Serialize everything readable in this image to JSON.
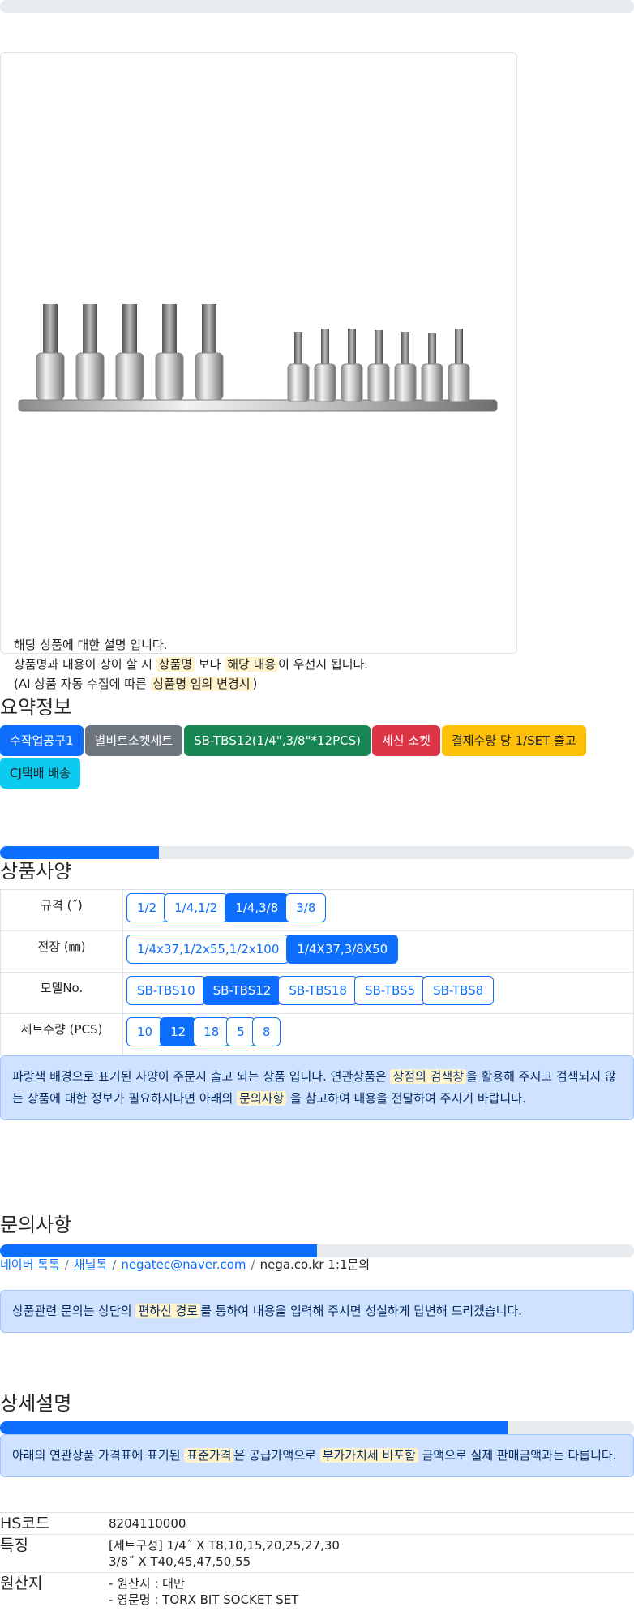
{
  "product": {
    "description_lines": [
      {
        "parts": [
          {
            "text": "해당 상품에 대한 설명 입니다.",
            "hl": false
          }
        ]
      },
      {
        "parts": [
          {
            "text": "상품명과 내용이 상이 할 시 ",
            "hl": false
          },
          {
            "text": "상품명",
            "hl": true
          },
          {
            "text": " 보다 ",
            "hl": false
          },
          {
            "text": "해당 내용",
            "hl": true
          },
          {
            "text": "이 우선시 됩니다.",
            "hl": false
          }
        ]
      },
      {
        "parts": [
          {
            "text": "(AI 상품 자동 수집에 따른 ",
            "hl": false
          },
          {
            "text": "상품명 임의 변경시",
            "hl": true
          },
          {
            "text": ")",
            "hl": false
          }
        ]
      }
    ]
  },
  "summary": {
    "title": "요약정보",
    "badges": [
      {
        "label": "수작업공구1",
        "color": "blue"
      },
      {
        "label": "별비트소켓세트",
        "color": "gray"
      },
      {
        "label": "SB-TBS12(1/4\",3/8\"*12PCS)",
        "color": "green"
      },
      {
        "label": "세신 소켓",
        "color": "red"
      },
      {
        "label": "결제수량 당 1/SET 출고",
        "color": "yellow"
      },
      {
        "label": "CJ택배 배송",
        "color": "cyan"
      }
    ]
  },
  "spec": {
    "title": "상품사양",
    "progress": 0.25,
    "rows": [
      {
        "label": "규격 (˝)",
        "options": [
          "1/2",
          "1/4,1/2",
          "1/4,3/8",
          "3/8"
        ],
        "selected": 2
      },
      {
        "label": "전장 (㎜)",
        "options": [
          "1/4x37,1/2x55,1/2x100",
          "1/4X37,3/8X50"
        ],
        "selected": 1
      },
      {
        "label": "모델No.",
        "options": [
          "SB-TBS10",
          "SB-TBS12",
          "SB-TBS18",
          "SB-TBS5",
          "SB-TBS8"
        ],
        "selected": 1
      },
      {
        "label": "세트수량 (PCS)",
        "options": [
          "10",
          "12",
          "18",
          "5",
          "8"
        ],
        "selected": 1
      }
    ],
    "notice": [
      {
        "text": "파랑색 배경으로 표기된 사양이 주문시 출고 되는 상품 입니다. 연관상품은 ",
        "hl": false
      },
      {
        "text": "상점의 검색창",
        "hl": true
      },
      {
        "text": "을 활용해 주시고 검색되지 않는 상품에 대한 정보가 필요하시다면 아래의 ",
        "hl": false
      },
      {
        "text": "문의사항",
        "hl": true
      },
      {
        "text": " 을 참고하여 내용을 전달하여 주시기 바랍니다.",
        "hl": false
      }
    ]
  },
  "inquiry": {
    "title": "문의사항",
    "progress": 0.5,
    "links": [
      "네이버 톡톡",
      "채널톡",
      "negatec@naver.com"
    ],
    "plain": "nega.co.kr 1:1문의",
    "notice": [
      {
        "text": "상품관련 문의는 상단의 ",
        "hl": false
      },
      {
        "text": "편하신 경로",
        "hl": true
      },
      {
        "text": "를 통하여 내용을 입력해 주시면 성실하게 답변해 드리겠습니다.",
        "hl": false
      }
    ]
  },
  "detail": {
    "title": "상세설명",
    "progress": 0.8,
    "notice": [
      {
        "text": "아래의 연관상품 가격표에 표기된 ",
        "hl": false
      },
      {
        "text": "표준가격",
        "hl": true
      },
      {
        "text": "은 공급가액으로 ",
        "hl": false
      },
      {
        "text": "부가가치세 비포함",
        "hl": true
      },
      {
        "text": " 금액으로 실제 판매금액과는 다릅니다.",
        "hl": false
      }
    ],
    "info": [
      {
        "key": "HS코드",
        "lines": [
          "8204110000"
        ]
      },
      {
        "key": "특징",
        "lines": [
          "[세트구성] 1/4˝ X T8,10,15,20,25,27,30",
          "3/8˝ X T40,45,47,50,55"
        ]
      },
      {
        "key": "원산지",
        "lines": [
          "- 원산지 : 대만",
          "- 영문명 : TORX BIT SOCKET SET"
        ]
      }
    ]
  }
}
